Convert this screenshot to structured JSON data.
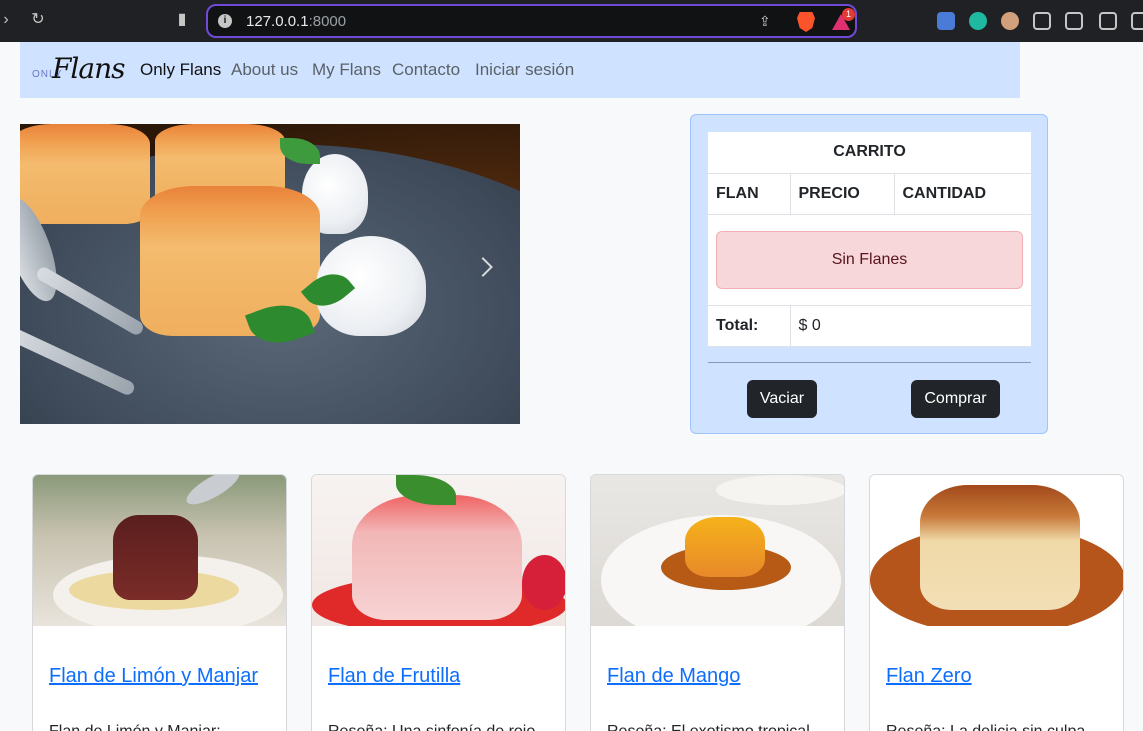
{
  "browser": {
    "url_host": "127.0.0.1",
    "url_port": ":8000",
    "rewards_badge": "1"
  },
  "navbar": {
    "logo_small": "ONLY",
    "logo_big": "Flans",
    "brand": "Only Flans",
    "links": [
      "About us",
      "My Flans",
      "Contacto",
      "Iniciar sesión"
    ]
  },
  "cart": {
    "title": "CARRITO",
    "columns": [
      "FLAN",
      "PRECIO",
      "CANTIDAD"
    ],
    "empty_message": "Sin Flanes",
    "total_label": "Total:",
    "total_value": "$ 0",
    "empty_button": "Vaciar",
    "buy_button": "Comprar"
  },
  "products": [
    {
      "name": "Flan de Limón y Manjar",
      "description": "Flan de Limón y Manjar:"
    },
    {
      "name": "Flan de Frutilla",
      "description": "Reseña: Una sinfonía de rojo"
    },
    {
      "name": "Flan de Mango",
      "description": "Reseña: El exotismo tropical"
    },
    {
      "name": "Flan Zero",
      "description": "Reseña: La delicia sin culpa"
    }
  ]
}
